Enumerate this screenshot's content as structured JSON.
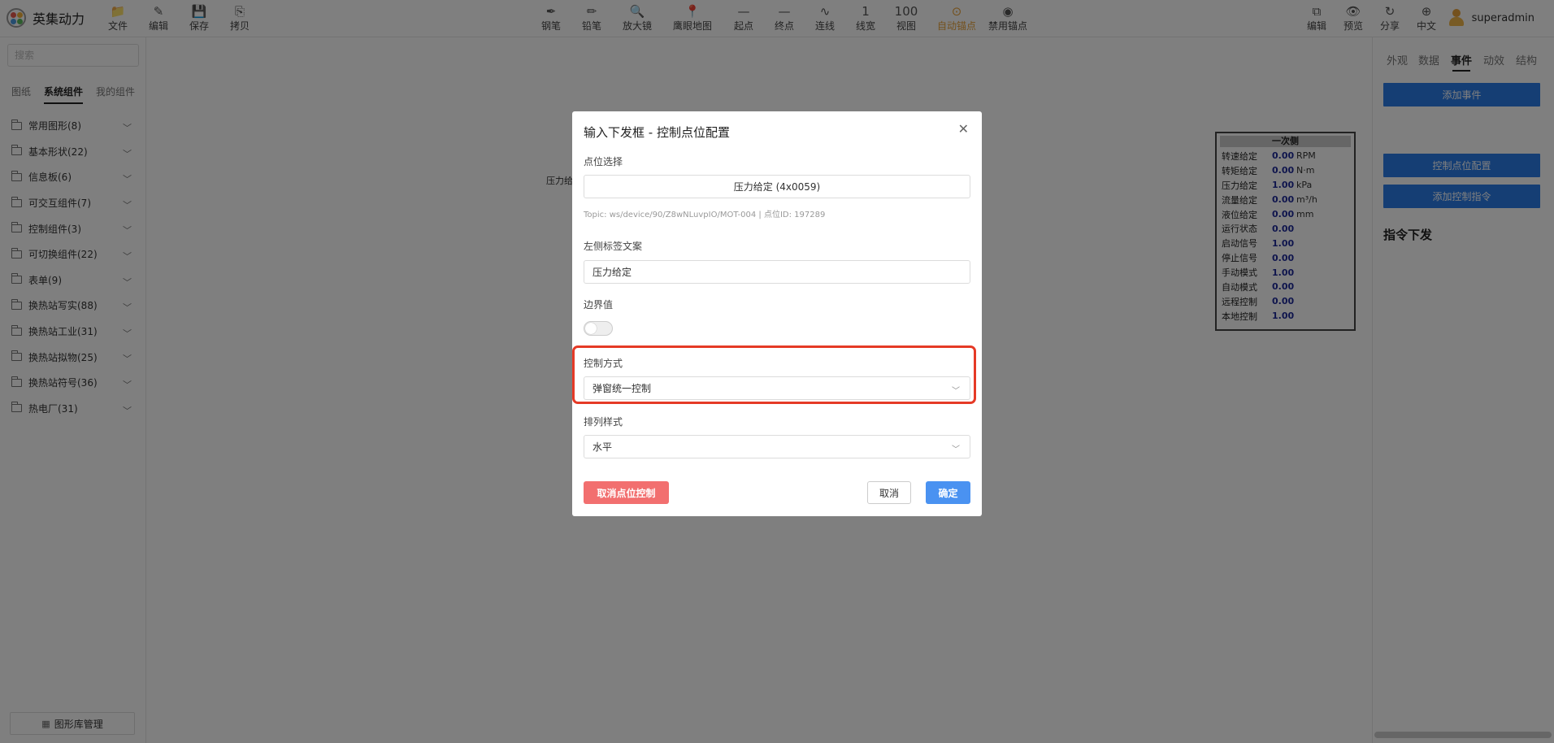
{
  "app": {
    "title": "英集动力",
    "user": "superadmin"
  },
  "toolbar": {
    "left": [
      {
        "label": "文件",
        "icon": "📁"
      },
      {
        "label": "编辑",
        "icon": "✎"
      },
      {
        "label": "保存",
        "icon": "💾"
      },
      {
        "label": "拷贝",
        "icon": "⎘"
      }
    ],
    "center": [
      {
        "label": "钢笔",
        "icon": "✒"
      },
      {
        "label": "铅笔",
        "icon": "✏"
      },
      {
        "label": "放大镜",
        "icon": "🔍"
      },
      {
        "label": "鹰眼地图",
        "icon": "📍"
      },
      {
        "label": "起点",
        "icon": "—"
      },
      {
        "label": "终点",
        "icon": "—"
      },
      {
        "label": "连线",
        "icon": "∿"
      },
      {
        "label": "线宽",
        "icon": "1"
      },
      {
        "label": "视图",
        "icon": "100"
      },
      {
        "label": "自动锚点",
        "icon": "⊙"
      },
      {
        "label": "禁用锚点",
        "icon": "◉"
      }
    ],
    "right": [
      {
        "label": "编辑",
        "icon": "⧉"
      },
      {
        "label": "预览",
        "icon": "👁"
      },
      {
        "label": "分享",
        "icon": "↻"
      },
      {
        "label": "中文",
        "icon": "⊕"
      }
    ]
  },
  "sidebar": {
    "search_placeholder": "搜索",
    "tabs": [
      "图纸",
      "系统组件",
      "我的组件"
    ],
    "groups": [
      "常用图形(8)",
      "基本形状(22)",
      "信息板(6)",
      "可交互组件(7)",
      "控制组件(3)",
      "可切换组件(22)",
      "表单(9)",
      "换热站写实(88)",
      "换热站工业(31)",
      "换热站拟物(25)",
      "换热站符号(36)",
      "热电厂(31)"
    ],
    "library_button": "图形库管理"
  },
  "right_panel": {
    "tabs": [
      "外观",
      "数据",
      "事件",
      "动效",
      "结构"
    ],
    "add_event": "添加事件",
    "control_point_config": "控制点位配置",
    "add_control_command": "添加控制指令",
    "command_header": "指令下发"
  },
  "canvas": {
    "partial_label": "压力给",
    "monitor": {
      "title": "一次侧",
      "rows": [
        {
          "label": "转速给定",
          "value": "0.00",
          "unit": "RPM"
        },
        {
          "label": "转矩给定",
          "value": "0.00",
          "unit": "N·m"
        },
        {
          "label": "压力给定",
          "value": "1.00",
          "unit": "kPa"
        },
        {
          "label": "流量给定",
          "value": "0.00",
          "unit": "m³/h"
        },
        {
          "label": "液位给定",
          "value": "0.00",
          "unit": "mm"
        },
        {
          "label": "运行状态",
          "value": "0.00",
          "unit": ""
        },
        {
          "label": "启动信号",
          "value": "1.00",
          "unit": ""
        },
        {
          "label": "停止信号",
          "value": "0.00",
          "unit": ""
        },
        {
          "label": "手动模式",
          "value": "1.00",
          "unit": ""
        },
        {
          "label": "自动模式",
          "value": "0.00",
          "unit": ""
        },
        {
          "label": "远程控制",
          "value": "0.00",
          "unit": ""
        },
        {
          "label": "本地控制",
          "value": "1.00",
          "unit": ""
        }
      ]
    }
  },
  "dialog": {
    "title": "输入下发框 - 控制点位配置",
    "point_select_label": "点位选择",
    "point_select_value": "压力给定 (4x0059)",
    "topic_hint": "Topic: ws/device/90/Z8wNLuvpIO/MOT-004 | 点位ID: 197289",
    "left_label_label": "左侧标签文案",
    "left_label_value": "压力给定",
    "boundary_label": "边界值",
    "control_mode_label": "控制方式",
    "control_mode_value": "弹窗统一控制",
    "layout_label": "排列样式",
    "layout_value": "水平",
    "cancel_control_button": "取消点位控制",
    "cancel_button": "取消",
    "ok_button": "确定"
  },
  "colors": {
    "primary": "#2b7de9",
    "danger": "#f26f6f",
    "highlight": "#e53a26",
    "active_tool": "#e8a23a"
  }
}
